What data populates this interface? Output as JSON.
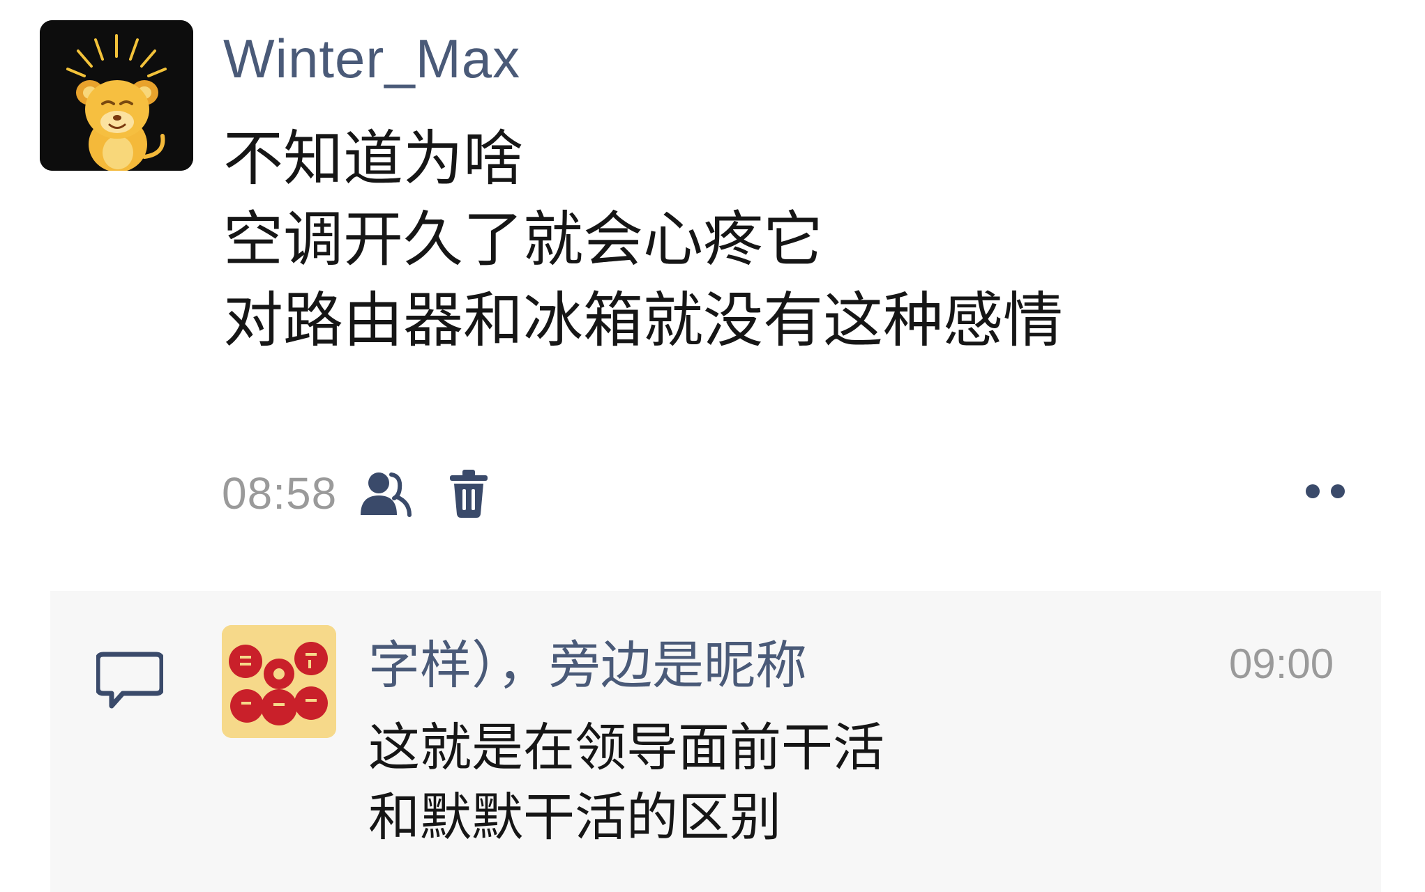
{
  "post": {
    "author": "Winter_Max",
    "avatar_icon": "cartoon-lion-cub-avatar",
    "lines": [
      "不知道为啥",
      "空调开久了就会心疼它",
      "对路由器和冰箱就没有这种感情"
    ],
    "time": "08:58",
    "visibility_icon": "people-icon",
    "delete_icon": "trash-icon",
    "more_icon": "more-dots-icon"
  },
  "comment": {
    "icon": "comment-icon",
    "avatar_icon": "red-festive-stamp-avatar",
    "name": "字样），旁边是昵称",
    "time": "09:00",
    "lines": [
      "这就是在领导面前干活",
      "和默默干活的区别"
    ]
  },
  "colors": {
    "name": "#4a5a78",
    "meta_gray": "#9a9a9a",
    "icon_navy": "#3a4a6a",
    "panel_bg": "#f7f7f7"
  }
}
